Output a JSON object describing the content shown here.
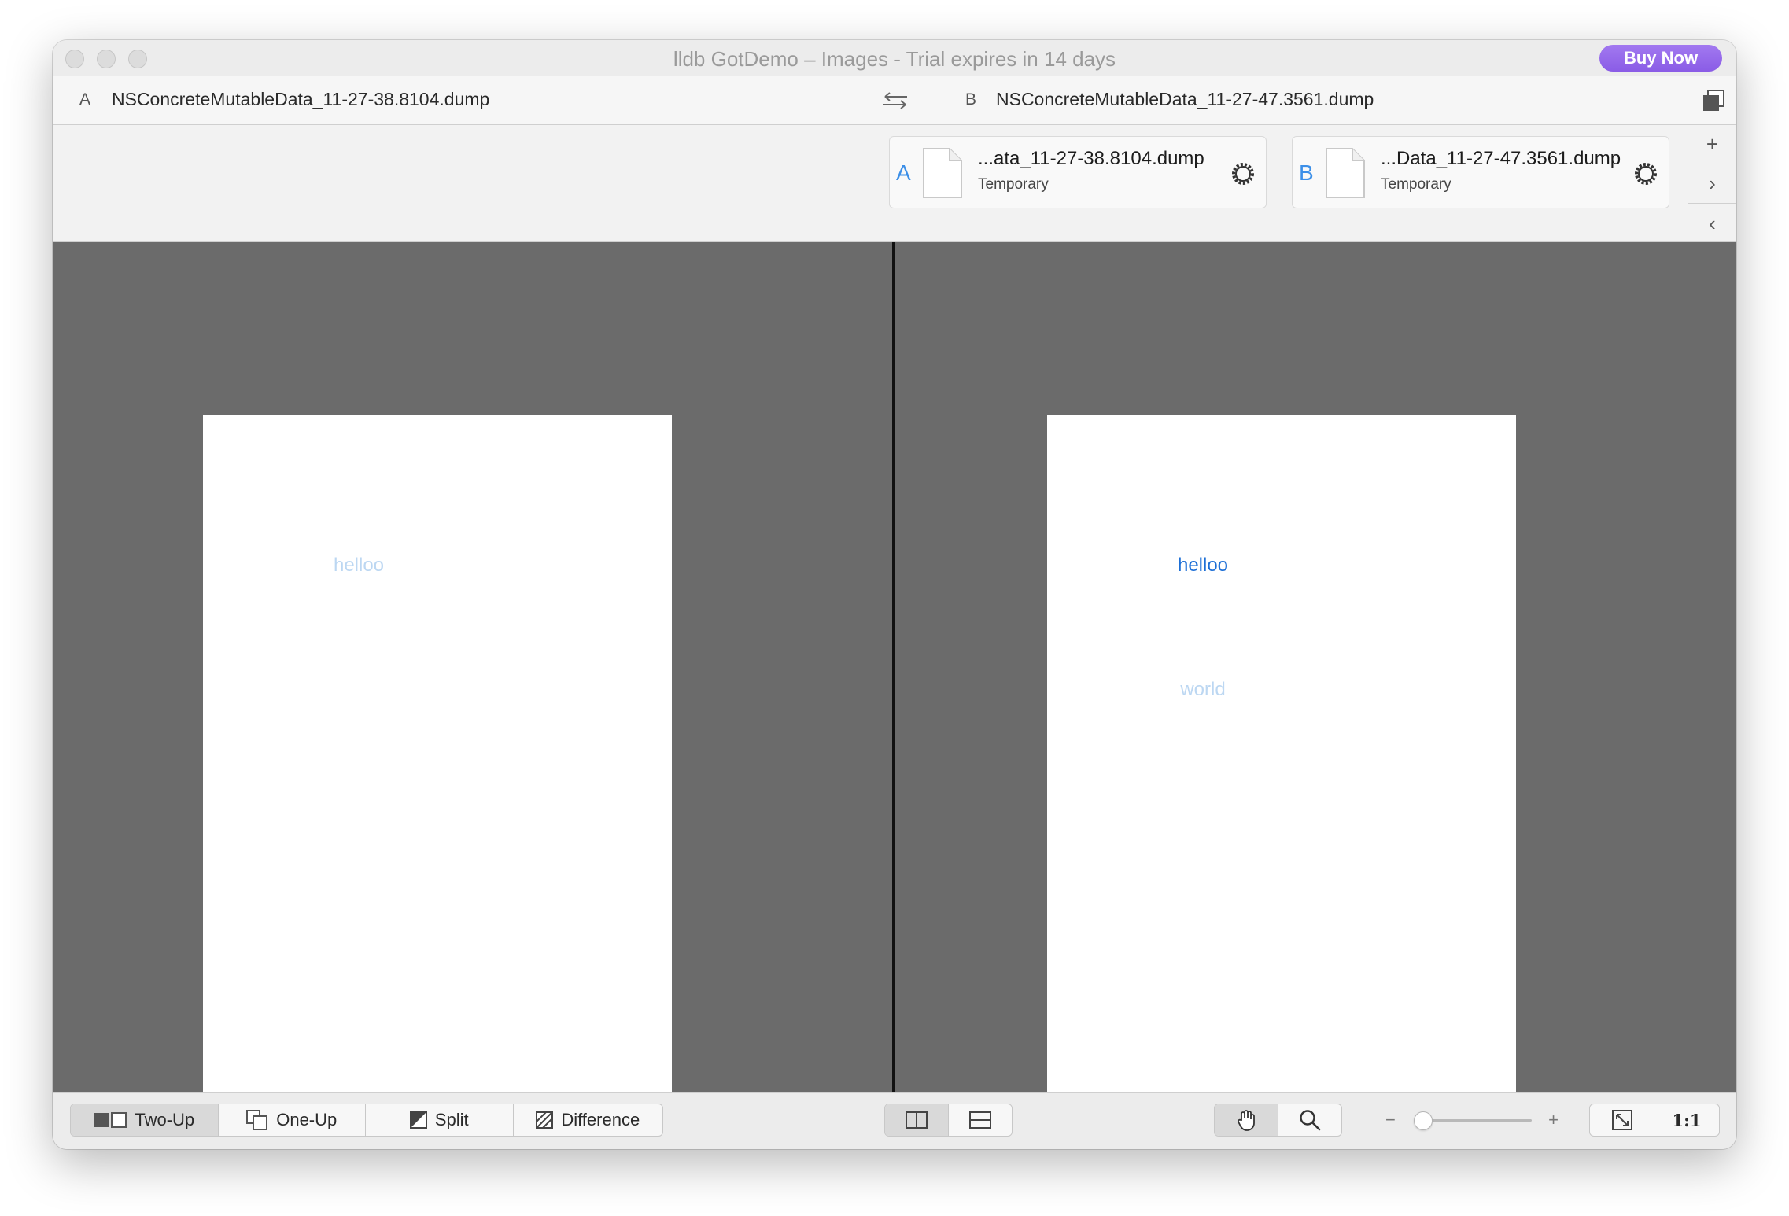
{
  "window": {
    "title": "lldb GotDemo – Images - Trial expires in 14 days",
    "buy_label": "Buy Now"
  },
  "pathbar": {
    "a_letter": "A",
    "a_name": "NSConcreteMutableData_11-27-38.8104.dump",
    "b_letter": "B",
    "b_name": "NSConcreteMutableData_11-27-47.3561.dump"
  },
  "files": [
    {
      "letter": "A",
      "name": "...ata_11-27-38.8104.dump",
      "type": "Temporary"
    },
    {
      "letter": "B",
      "name": "...Data_11-27-47.3561.dump",
      "type": "Temporary"
    }
  ],
  "side_buttons": {
    "add": "+",
    "next": "›",
    "prev": "‹"
  },
  "left_page": {
    "lines": [
      "helloo"
    ]
  },
  "right_page": {
    "lines": [
      "helloo",
      "world"
    ]
  },
  "toolbar": {
    "modes": [
      "Two-Up",
      "One-Up",
      "Split",
      "Difference"
    ],
    "selected_mode": "Two-Up",
    "zoom_minus": "−",
    "zoom_plus": "+",
    "actual_size_label": "1:1",
    "zoom_level": 0.08
  },
  "colors": {
    "accent_text": "#1d6fd6",
    "faded_text": "#bcd7f2",
    "buy_button": "#9a6cec",
    "canvas": "#6b6b6b"
  }
}
